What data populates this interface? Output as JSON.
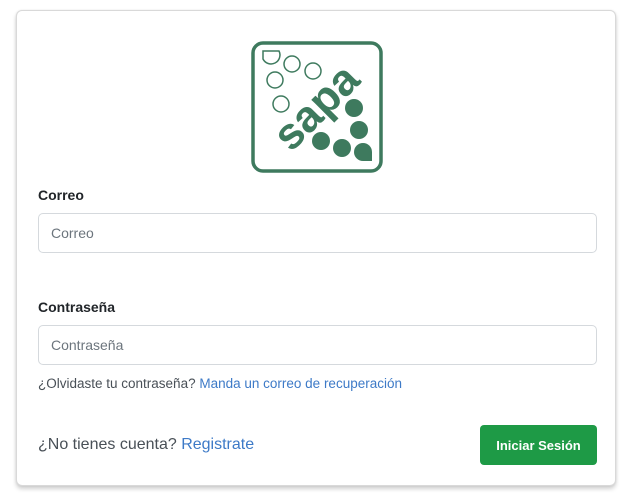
{
  "brand": {
    "logo_text": "sapa",
    "color": "#3e7a5e"
  },
  "form": {
    "email_label": "Correo",
    "email_placeholder": "Correo",
    "email_value": "",
    "password_label": "Contraseña",
    "password_placeholder": "Contraseña",
    "password_value": "",
    "forgot_text": "¿Olvidaste tu contraseña?",
    "forgot_link": "Manda un correo de recuperación",
    "no_account_text": "¿No tienes cuenta?",
    "register_link": "Registrate",
    "submit_label": "Iniciar Sesión"
  },
  "colors": {
    "primary_button": "#1e9a46",
    "link": "#3d7ac7"
  }
}
